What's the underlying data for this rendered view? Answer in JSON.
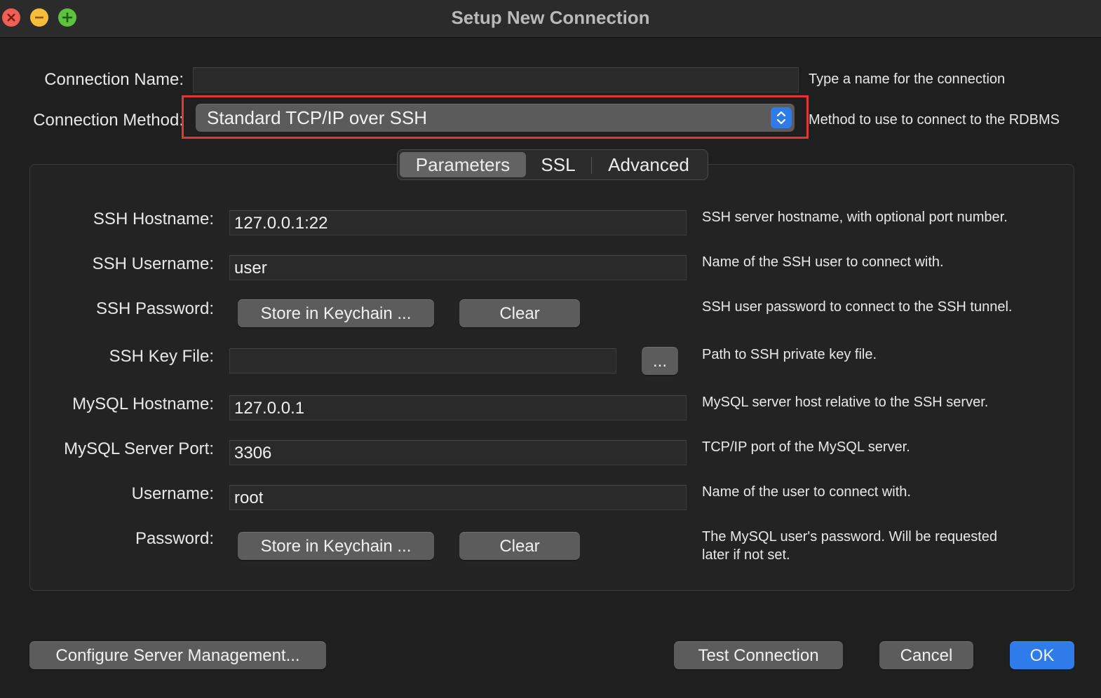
{
  "window": {
    "title": "Setup New Connection"
  },
  "connection_name": {
    "label": "Connection Name:",
    "value": "",
    "help": "Type a name for the connection"
  },
  "connection_method": {
    "label": "Connection Method:",
    "selected": "Standard TCP/IP over SSH",
    "help": "Method to use to connect to the RDBMS"
  },
  "tabs": [
    {
      "label": "Parameters",
      "active": true
    },
    {
      "label": "SSL",
      "active": false
    },
    {
      "label": "Advanced",
      "active": false
    }
  ],
  "parameters": {
    "ssh_hostname": {
      "label": "SSH Hostname:",
      "value": "127.0.0.1:22",
      "help": "SSH server hostname, with  optional port number."
    },
    "ssh_username": {
      "label": "SSH Username:",
      "value": "user",
      "help": "Name of the SSH user to connect with."
    },
    "ssh_password": {
      "label": "SSH Password:",
      "store_label": "Store in Keychain ...",
      "clear_label": "Clear",
      "help": "SSH user password to connect to the SSH tunnel."
    },
    "ssh_key_file": {
      "label": "SSH Key File:",
      "value": "",
      "browse_label": "...",
      "help": "Path to SSH private key file."
    },
    "mysql_hostname": {
      "label": "MySQL Hostname:",
      "value": "127.0.0.1",
      "help": "MySQL server host relative to the SSH server."
    },
    "mysql_port": {
      "label": "MySQL Server Port:",
      "value": "3306",
      "help": "TCP/IP port of the MySQL server."
    },
    "username": {
      "label": "Username:",
      "value": "root",
      "help": "Name of the user to connect with."
    },
    "password": {
      "label": "Password:",
      "store_label": "Store in Keychain ...",
      "clear_label": "Clear",
      "help_line1": "The MySQL user's password. Will be requested",
      "help_line2": "later if not set."
    }
  },
  "footer": {
    "configure_label": "Configure Server Management...",
    "test_label": "Test Connection",
    "cancel_label": "Cancel",
    "ok_label": "OK"
  },
  "colors": {
    "background": "#1f1f1f",
    "accent": "#2f7bea",
    "highlight": "#e0382d",
    "close": "#ee5f57",
    "minimize": "#f6bd3b",
    "maximize": "#5fc140"
  },
  "icons": {
    "close": "close-icon",
    "minimize": "minimize-icon",
    "maximize": "maximize-icon",
    "stepper": "chevron-up-down-icon"
  }
}
